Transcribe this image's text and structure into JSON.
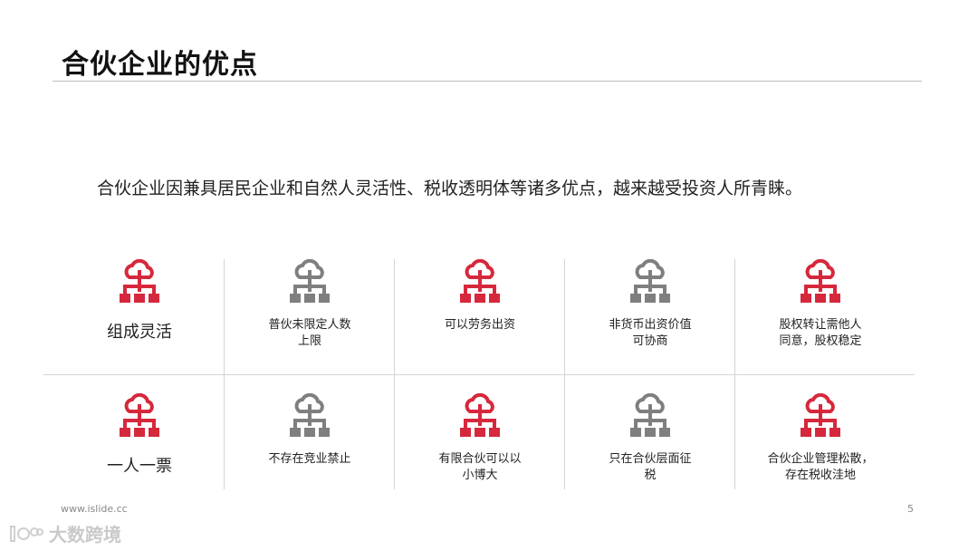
{
  "slide": {
    "title": "合伙企业的优点",
    "intro": "合伙企业因兼具居民企业和自然人灵活性、税收透明体等诸多优点，越来越受投资人所青睐。",
    "footer_url": "www.islide.cc",
    "page_number": "5",
    "watermark": "大数跨境"
  },
  "colors": {
    "accent_red": "#d6283c",
    "neutral_gray": "#7f7f7f",
    "rule": "#bdbdbd"
  },
  "icon_name": "cloud-network-icon",
  "cards": [
    {
      "label": "组成灵活",
      "icon_color": "red",
      "big": true
    },
    {
      "label": "普伙未限定人数\n上限",
      "icon_color": "gray",
      "big": false
    },
    {
      "label": "可以劳务出资",
      "icon_color": "red",
      "big": false
    },
    {
      "label": "非货币出资价值\n可协商",
      "icon_color": "gray",
      "big": false
    },
    {
      "label": "股权转让需他人\n同意，股权稳定",
      "icon_color": "red",
      "big": false
    },
    {
      "label": "一人一票",
      "icon_color": "red",
      "big": true
    },
    {
      "label": "不存在竞业禁止",
      "icon_color": "gray",
      "big": false
    },
    {
      "label": "有限合伙可以以\n小博大",
      "icon_color": "red",
      "big": false
    },
    {
      "label": "只在合伙层面征\n税",
      "icon_color": "gray",
      "big": false
    },
    {
      "label": "合伙企业管理松散，\n存在税收洼地",
      "icon_color": "red",
      "big": false
    }
  ]
}
